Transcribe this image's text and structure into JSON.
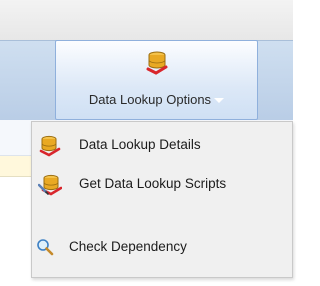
{
  "ribbon": {
    "button": {
      "label": "Data Lookup Options",
      "icon": "database-lookup-icon"
    }
  },
  "menu": {
    "items": [
      {
        "label": "Data Lookup Details",
        "icon": "database-details-icon"
      },
      {
        "label": "Get Data Lookup Scripts",
        "icon": "database-script-icon"
      },
      {
        "label": "Check Dependency",
        "icon": "magnifier-icon"
      }
    ]
  }
}
